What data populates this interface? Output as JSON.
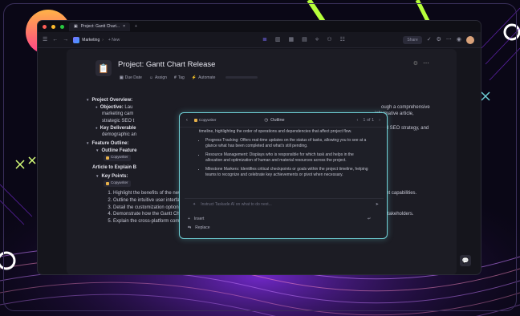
{
  "browser": {
    "tab_title": "Project: Gantt Chart...",
    "tab_close": "×",
    "new_tab": "+"
  },
  "toolbar": {
    "workspace": "Marketing",
    "new_label": "+ New",
    "share_label": "Share"
  },
  "page": {
    "icon": "📋",
    "title": "Project: Gantt Chart Release",
    "meta": {
      "due_date": "Due Date",
      "assign": "Assign",
      "tag": "Tag",
      "automate": "Automate"
    }
  },
  "doc": {
    "overview_heading": "Project Overview:",
    "objective_label": "Objective:",
    "objective_text": "Lau",
    "objective_tail": "ough a comprehensive",
    "obj_line2": "marketing cam",
    "obj_line2_tail": "informative article,",
    "obj_line3": "strategic SEO t",
    "key_deliverables_label": "Key Deliverable",
    "key_deliverables_tail": "rgeted SEO strategy, and",
    "kd_line2": "demographic an",
    "feature_outline_heading": "Feature Outline:",
    "outline_feature": "Outline Feature",
    "copywriter_pill": "Copywriter",
    "article_heading": "Article to Explain B",
    "key_points_label": "Key Points:",
    "points": [
      "Highlight the benefits of the new Gantt Chart feature, emphasizing enhanced project visualization and improved time management capabilities.",
      "Outline the intuitive user interface of the Gantt Chart, designed for seamless integration into existing workflows.",
      "Detail the customization options available within the Gantt Chart, allowing users to tailor it to their specific project needs.",
      "Demonstrate how the Gantt Chart supports team collaboration by enabling real-time updates and shared access among project stakeholders.",
      "Explain the cross-platform compatibility of the Gantt Chart, ensuring functionality across various devices and operating systems."
    ]
  },
  "popup": {
    "agent": "Copywriter",
    "mode": "Outline",
    "pager": "1 of 1",
    "intro": "timeline, highlighting the order of operations and dependencies that affect project flow.",
    "items": [
      "Progress Tracking: Offers real-time updates on the status of tasks, allowing you to see at a glance what has been completed and what's still pending.",
      "Resource Management: Displays who is responsible for which task and helps in the allocation and optimization of human and material resources across the project.",
      "Milestone Markers: Identifies critical checkpoints or goals within the project timeline, helping teams to recognize and celebrate key achievements or pivot when necessary."
    ],
    "input_placeholder": "Instruct Taskade AI on what to do next...",
    "insert": "Insert",
    "replace": "Replace"
  },
  "colors": {
    "accent": "#6fd0d6",
    "background": "#0a0716",
    "window": "#15151c"
  }
}
